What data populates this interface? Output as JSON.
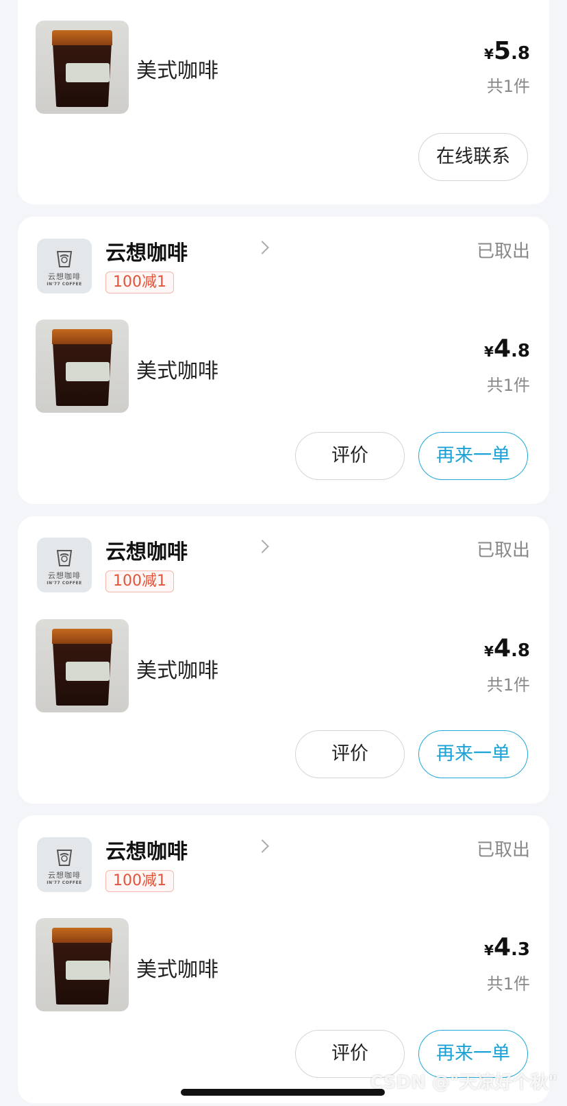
{
  "first_card": {
    "product_name": "美式咖啡",
    "price_currency": "¥",
    "price_integer": "5",
    "price_decimal": ".8",
    "quantity": "共1件",
    "contact_button": "在线联系"
  },
  "orders": [
    {
      "shop_name": "云想咖啡",
      "promo_tag": "100减1",
      "status": "已取出",
      "product_name": "美式咖啡",
      "price_currency": "¥",
      "price_integer": "4",
      "price_decimal": ".8",
      "quantity": "共1件",
      "review_button": "评价",
      "reorder_button": "再来一单"
    },
    {
      "shop_name": "云想咖啡",
      "promo_tag": "100减1",
      "status": "已取出",
      "product_name": "美式咖啡",
      "price_currency": "¥",
      "price_integer": "4",
      "price_decimal": ".8",
      "quantity": "共1件",
      "review_button": "评价",
      "reorder_button": "再来一单"
    },
    {
      "shop_name": "云想咖啡",
      "promo_tag": "100减1",
      "status": "已取出",
      "product_name": "美式咖啡",
      "price_currency": "¥",
      "price_integer": "4",
      "price_decimal": ".3",
      "quantity": "共1件",
      "review_button": "评价",
      "reorder_button": "再来一单"
    }
  ],
  "shop_logo": {
    "brand_cn": "云想咖啡",
    "brand_en": "IN'77 COFFEE"
  },
  "watermark": "CSDN @\"天凉好个秋\"",
  "colors": {
    "accent_blue": "#1aa1d6",
    "promo_red": "#e2543a",
    "background": "#f3f5f8"
  }
}
